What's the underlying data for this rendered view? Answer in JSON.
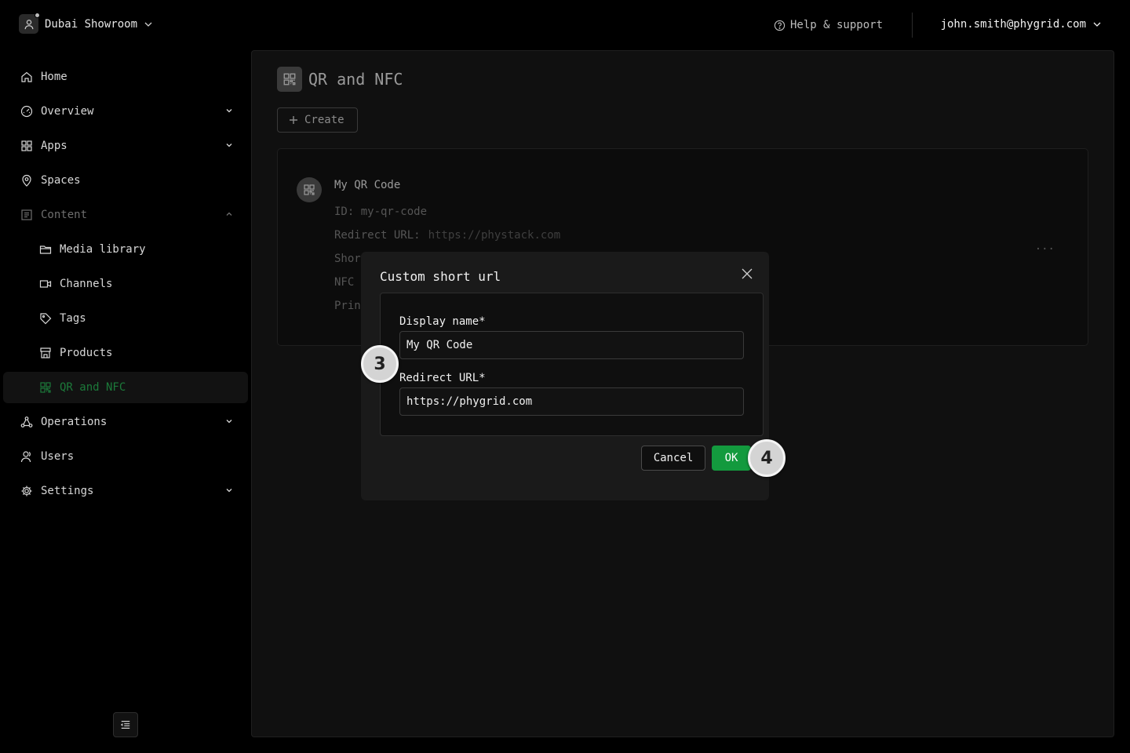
{
  "topbar": {
    "org_name": "Dubai Showroom",
    "help_label": "Help & support",
    "user_email": "john.smith@phygrid.com"
  },
  "sidebar": {
    "items": [
      {
        "label": "Home",
        "icon": "home-icon"
      },
      {
        "label": "Overview",
        "icon": "gauge-icon",
        "expandable": true
      },
      {
        "label": "Apps",
        "icon": "apps-grid-icon",
        "expandable": true
      },
      {
        "label": "Spaces",
        "icon": "map-pin-icon"
      },
      {
        "label": "Content",
        "icon": "content-icon",
        "expanded": true
      },
      {
        "label": "Media library",
        "icon": "folder-icon",
        "sub": true
      },
      {
        "label": "Channels",
        "icon": "video-icon",
        "sub": true
      },
      {
        "label": "Tags",
        "icon": "tag-icon",
        "sub": true
      },
      {
        "label": "Products",
        "icon": "store-icon",
        "sub": true
      },
      {
        "label": "QR and NFC",
        "icon": "qr-icon",
        "sub": true,
        "active": true
      },
      {
        "label": "Operations",
        "icon": "network-icon",
        "expandable": true
      },
      {
        "label": "Users",
        "icon": "users-icon"
      },
      {
        "label": "Settings",
        "icon": "gear-icon",
        "expandable": true
      }
    ],
    "active_color": "#1c7a3a"
  },
  "page": {
    "title": "QR and NFC",
    "create_label": "Create"
  },
  "card": {
    "title": "My QR Code",
    "id_line": "ID: my-qr-code",
    "redirect_label": "Redirect URL:",
    "redirect_value": "https://phystack.com",
    "short_label": "Shor",
    "nfc_label": "NFC",
    "print_label": "Prin",
    "more": "..."
  },
  "modal": {
    "title": "Custom short url",
    "display_name_label": "Display name*",
    "display_name_value": "My QR Code",
    "redirect_url_label": "Redirect URL*",
    "redirect_url_value": "https://phygrid.com",
    "cancel_label": "Cancel",
    "ok_label": "OK",
    "ok_color": "#139a3e"
  },
  "steps": {
    "form_step": "3",
    "ok_step": "4"
  }
}
